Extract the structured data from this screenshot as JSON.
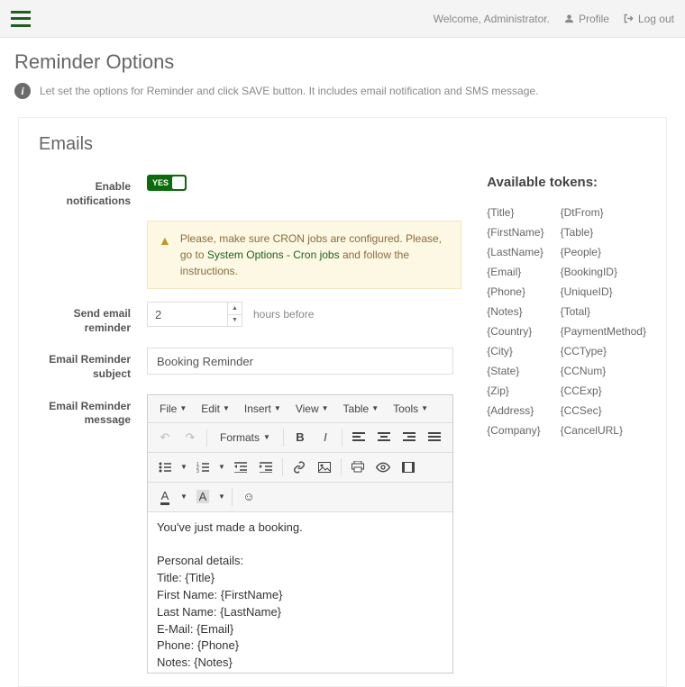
{
  "topbar": {
    "welcome": "Welcome, Administrator.",
    "profile": "Profile",
    "logout": "Log out"
  },
  "page": {
    "title": "Reminder Options",
    "desc": "Let set the options for Reminder and click SAVE button. It includes email notification and SMS message."
  },
  "section": {
    "emails": "Emails"
  },
  "form": {
    "enable_label": "Enable notifications",
    "toggle_state": "YES",
    "cron_warning_1": "Please, make sure CRON jobs are configured. Please, go to ",
    "cron_link": "System Options - Cron jobs",
    "cron_warning_2": " and follow the instructions.",
    "send_label": "Send email reminder",
    "send_value": "2",
    "send_hint": "hours before",
    "subject_label": "Email Reminder subject",
    "subject_value": "Booking Reminder",
    "message_label": "Email Reminder message",
    "editor_menus": {
      "file": "File",
      "edit": "Edit",
      "insert": "Insert",
      "view": "View",
      "table": "Table",
      "tools": "Tools"
    },
    "formats": "Formats",
    "message_body": "You've just made a booking.\n\nPersonal details:\nTitle: {Title}\nFirst Name: {FirstName}\nLast Name: {LastName}\nE-Mail: {Email}\nPhone: {Phone}\nNotes: {Notes}\nCountry: {Country}\nCity: {City}\nState: {State}\nZip: {Zip}\nAddress: {Address}\nCompany: {Company}"
  },
  "tokens": {
    "title": "Available tokens:",
    "col1": [
      "{Title}",
      "{FirstName}",
      "{LastName}",
      "{Email}",
      "{Phone}",
      "{Notes}",
      "{Country}",
      "{City}",
      "{State}",
      "{Zip}",
      "{Address}",
      "{Company}"
    ],
    "col2": [
      "{DtFrom}",
      "{Table}",
      "{People}",
      "{BookingID}",
      "{UniqueID}",
      "{Total}",
      "{PaymentMethod}",
      "{CCType}",
      "{CCNum}",
      "{CCExp}",
      "{CCSec}",
      "{CancelURL}"
    ]
  }
}
